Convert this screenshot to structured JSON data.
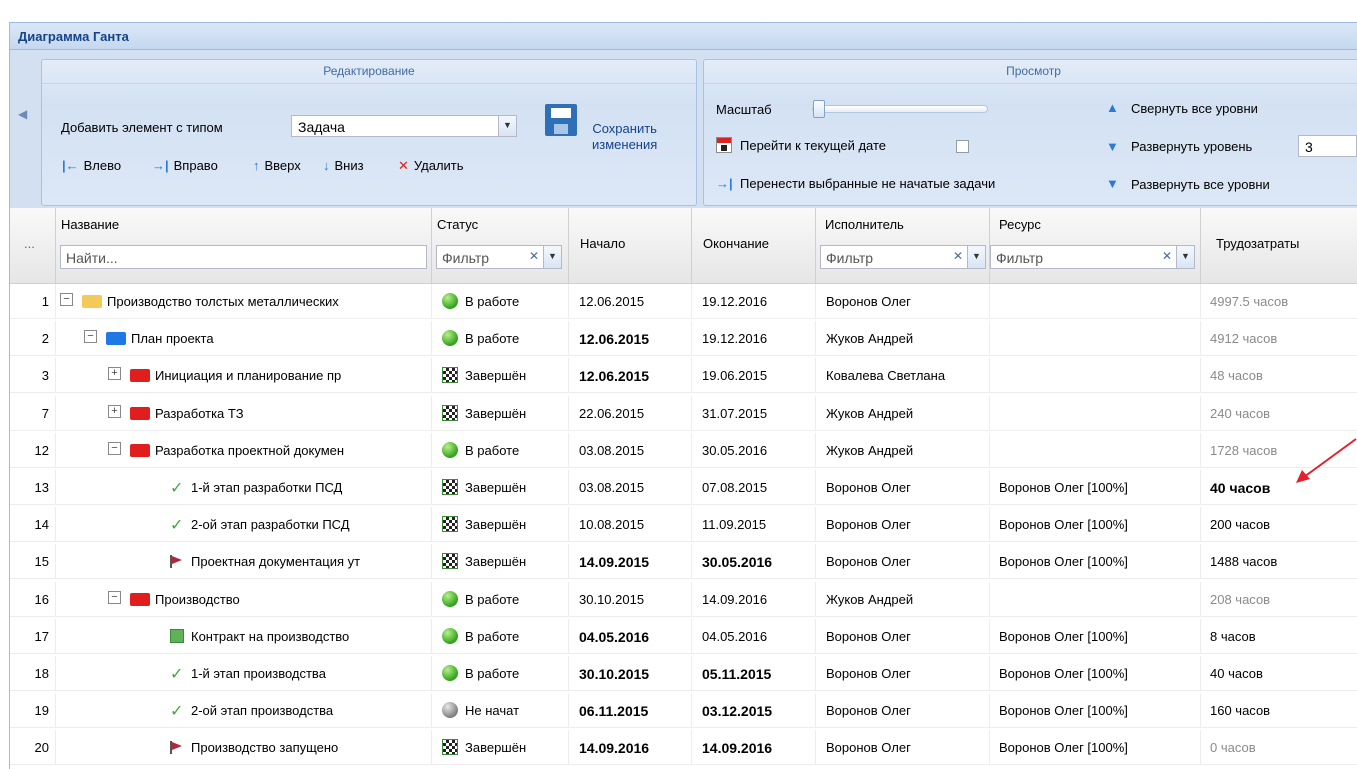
{
  "panel": {
    "title": "Диаграмма Ганта"
  },
  "toolbar": {
    "edit_group": {
      "title": "Редактирование",
      "add_label": "Добавить элемент с типом",
      "type_value": "Задача",
      "left": "Влево",
      "right": "Вправо",
      "up": "Вверх",
      "down": "Вниз",
      "delete": "Удалить",
      "save_line1": "Сохранить",
      "save_line2": "изменения"
    },
    "view_group": {
      "title": "Просмотр",
      "scale_label": "Масштаб",
      "goto_today": "Перейти к текущей дате",
      "move_tasks": "Перенести выбранные не начатые задачи",
      "collapse_all": "Свернуть все уровни",
      "expand_level": "Развернуть уровень",
      "expand_level_value": "3",
      "expand_all": "Развернуть все уровни"
    }
  },
  "grid": {
    "headers": {
      "more": "...",
      "name": "Название",
      "name_placeholder": "Найти...",
      "status": "Статус",
      "status_filter": "Фильтр",
      "start": "Начало",
      "end": "Окончание",
      "executor": "Исполнитель",
      "executor_filter": "Фильтр",
      "resource": "Ресурс",
      "resource_filter": "Фильтр",
      "work": "Трудозатраты"
    },
    "rows": [
      {
        "num": "1",
        "level": 0,
        "toggle": "−",
        "icon": "folder-yellow",
        "name": "Производство толстых металлических",
        "status": "В работе",
        "status_icon": "green",
        "start": "12.06.2015",
        "start_bold": false,
        "end": "19.12.2016",
        "end_bold": false,
        "executor": "Воронов Олег",
        "resource": "",
        "work": "4997.5 часов",
        "work_style": "gray"
      },
      {
        "num": "2",
        "level": 1,
        "toggle": "−",
        "icon": "folder-blue",
        "name": "План проекта",
        "status": "В работе",
        "status_icon": "green",
        "start": "12.06.2015",
        "start_bold": true,
        "end": "19.12.2016",
        "end_bold": false,
        "executor": "Жуков Андрей",
        "resource": "",
        "work": "4912 часов",
        "work_style": "gray"
      },
      {
        "num": "3",
        "level": 2,
        "toggle": "+",
        "icon": "folder-red",
        "name": "Инициация и планирование пр",
        "status": "Завершён",
        "status_icon": "flag",
        "start": "12.06.2015",
        "start_bold": true,
        "end": "19.06.2015",
        "end_bold": false,
        "executor": "Ковалева Светлана",
        "resource": "",
        "work": "48 часов",
        "work_style": "gray"
      },
      {
        "num": "7",
        "level": 2,
        "toggle": "+",
        "icon": "folder-red",
        "name": "Разработка ТЗ",
        "status": "Завершён",
        "status_icon": "flag",
        "start": "22.06.2015",
        "start_bold": false,
        "end": "31.07.2015",
        "end_bold": false,
        "executor": "Жуков Андрей",
        "resource": "",
        "work": "240 часов",
        "work_style": "gray"
      },
      {
        "num": "12",
        "level": 2,
        "toggle": "−",
        "icon": "folder-red",
        "name": "Разработка проектной докумен",
        "status": "В работе",
        "status_icon": "green",
        "start": "03.08.2015",
        "start_bold": false,
        "end": "30.05.2016",
        "end_bold": false,
        "executor": "Жуков Андрей",
        "resource": "",
        "work": "1728 часов",
        "work_style": "gray"
      },
      {
        "num": "13",
        "level": 3,
        "toggle": "",
        "icon": "check",
        "name": "1-й этап разработки ПСД",
        "status": "Завершён",
        "status_icon": "flag",
        "start": "03.08.2015",
        "start_bold": false,
        "end": "07.08.2015",
        "end_bold": false,
        "executor": "Воронов Олег",
        "resource": "Воронов Олег [100%]",
        "work": "40 часов",
        "work_style": "strong"
      },
      {
        "num": "14",
        "level": 3,
        "toggle": "",
        "icon": "check",
        "name": "2-ой этап разработки ПСД",
        "status": "Завершён",
        "status_icon": "flag",
        "start": "10.08.2015",
        "start_bold": false,
        "end": "11.09.2015",
        "end_bold": false,
        "executor": "Воронов Олег",
        "resource": "Воронов Олег [100%]",
        "work": "200 часов",
        "work_style": "normal"
      },
      {
        "num": "15",
        "level": 3,
        "toggle": "",
        "icon": "flag",
        "name": "Проектная документация ут",
        "status": "Завершён",
        "status_icon": "flag",
        "start": "14.09.2015",
        "start_bold": true,
        "end": "30.05.2016",
        "end_bold": true,
        "executor": "Воронов Олег",
        "resource": "Воронов Олег [100%]",
        "work": "1488 часов",
        "work_style": "normal"
      },
      {
        "num": "16",
        "level": 2,
        "toggle": "−",
        "icon": "folder-red",
        "name": "Производство",
        "status": "В работе",
        "status_icon": "green",
        "start": "30.10.2015",
        "start_bold": false,
        "end": "14.09.2016",
        "end_bold": false,
        "executor": "Жуков Андрей",
        "resource": "",
        "work": "208 часов",
        "work_style": "gray"
      },
      {
        "num": "17",
        "level": 3,
        "toggle": "",
        "icon": "contract",
        "name": "Контракт на производство",
        "status": "В работе",
        "status_icon": "green",
        "start": "04.05.2016",
        "start_bold": true,
        "end": "04.05.2016",
        "end_bold": false,
        "executor": "Воронов Олег",
        "resource": "Воронов Олег [100%]",
        "work": "8 часов",
        "work_style": "normal"
      },
      {
        "num": "18",
        "level": 3,
        "toggle": "",
        "icon": "check",
        "name": "1-й этап производства",
        "status": "В работе",
        "status_icon": "green",
        "start": "30.10.2015",
        "start_bold": true,
        "end": "05.11.2015",
        "end_bold": true,
        "executor": "Воронов Олег",
        "resource": "Воронов Олег [100%]",
        "work": "40 часов",
        "work_style": "normal"
      },
      {
        "num": "19",
        "level": 3,
        "toggle": "",
        "icon": "check",
        "name": "2-ой этап производства",
        "status": "Не начат",
        "status_icon": "gray",
        "start": "06.11.2015",
        "start_bold": true,
        "end": "03.12.2015",
        "end_bold": true,
        "executor": "Воронов Олег",
        "resource": "Воронов Олег [100%]",
        "work": "160 часов",
        "work_style": "normal"
      },
      {
        "num": "20",
        "level": 3,
        "toggle": "",
        "icon": "flag",
        "name": "Производство запущено",
        "status": "Завершён",
        "status_icon": "flag",
        "start": "14.09.2016",
        "start_bold": true,
        "end": "14.09.2016",
        "end_bold": true,
        "executor": "Воронов Олег",
        "resource": "Воронов Олег [100%]",
        "work": "0 часов",
        "work_style": "gray"
      }
    ]
  }
}
